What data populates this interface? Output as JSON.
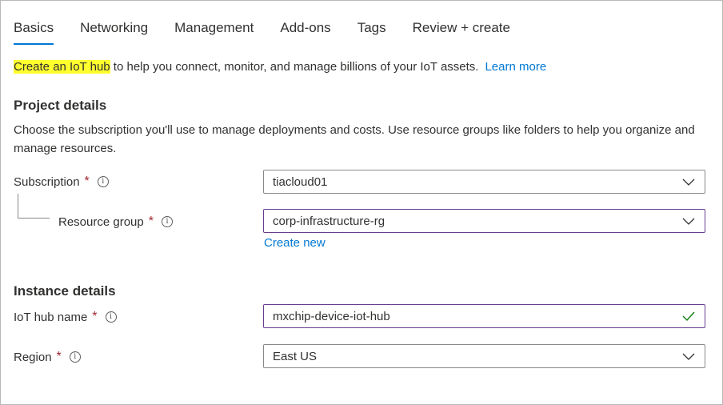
{
  "tabs": [
    {
      "label": "Basics",
      "active": true
    },
    {
      "label": "Networking",
      "active": false
    },
    {
      "label": "Management",
      "active": false
    },
    {
      "label": "Add-ons",
      "active": false
    },
    {
      "label": "Tags",
      "active": false
    },
    {
      "label": "Review + create",
      "active": false
    }
  ],
  "intro": {
    "highlight": "Create an IoT hub",
    "text": " to help you connect, monitor, and manage billions of your IoT assets.",
    "learn_more": "Learn more"
  },
  "project": {
    "title": "Project details",
    "description": "Choose the subscription you'll use to manage deployments and costs. Use resource groups like folders to help you organize and manage resources.",
    "subscription": {
      "label": "Subscription",
      "required": "*",
      "value": "tiacloud01"
    },
    "resource_group": {
      "label": "Resource group",
      "required": "*",
      "value": "corp-infrastructure-rg",
      "create_new": "Create new"
    }
  },
  "instance": {
    "title": "Instance details",
    "hub_name": {
      "label": "IoT hub name",
      "required": "*",
      "value": "mxchip-device-iot-hub"
    },
    "region": {
      "label": "Region",
      "required": "*",
      "value": "East US"
    }
  },
  "icons": {
    "info": "info-icon",
    "chevron": "chevron-down-icon",
    "valid": "checkmark-icon"
  },
  "colors": {
    "accent": "#0078d4",
    "required": "#a4262c",
    "highlight": "#ffff2e",
    "focus_border": "#6a3d8f",
    "valid": "#107c10"
  }
}
